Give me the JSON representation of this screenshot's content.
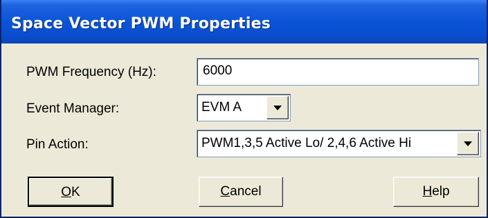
{
  "window": {
    "title": "Space Vector PWM Properties"
  },
  "fields": {
    "pwm_frequency": {
      "label": "PWM Frequency (Hz):",
      "value": "6000"
    },
    "event_manager": {
      "label": "Event Manager:",
      "selected": "EVM A"
    },
    "pin_action": {
      "label": "Pin Action:",
      "selected": "PWM1,3,5 Active Lo/ 2,4,6 Active Hi"
    }
  },
  "buttons": {
    "ok": {
      "mnemonic": "O",
      "rest": "K"
    },
    "cancel": {
      "mnemonic": "C",
      "rest": "ancel"
    },
    "help": {
      "mnemonic": "H",
      "rest": "elp"
    }
  },
  "icons": {
    "dropdown": "chevron-down-icon"
  }
}
